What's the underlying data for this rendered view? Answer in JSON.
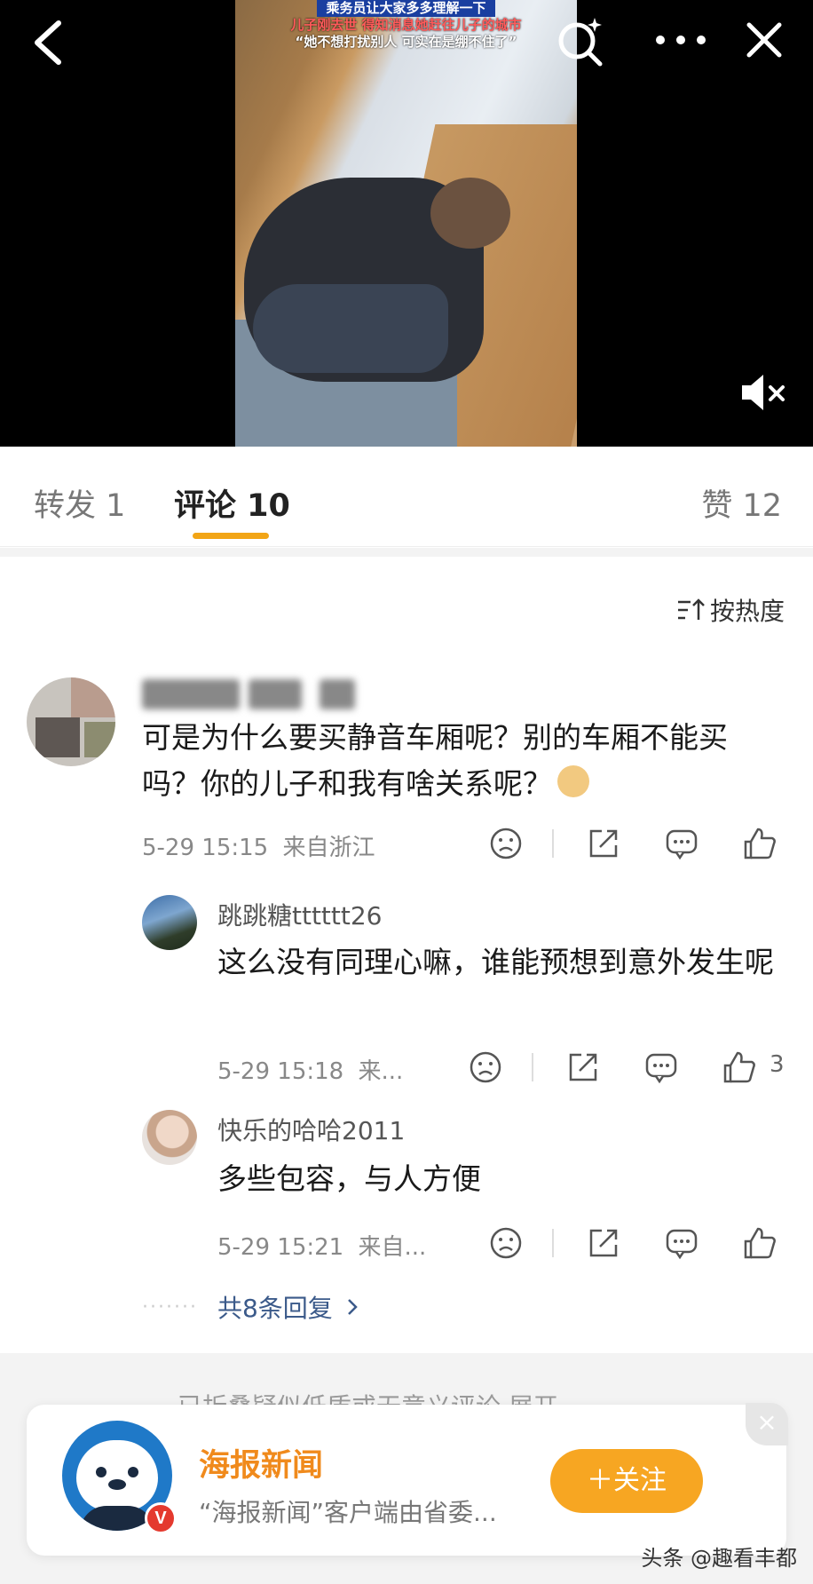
{
  "video": {
    "caption_line1": "乘务员让大家多多理解一下",
    "caption_line2": "儿子刚去世 得知消息她赶往儿子的城市",
    "caption_line3": "“她不想打扰别人 可实在是绷不住了”"
  },
  "tabs": {
    "repost": "转发 1",
    "comment": "评论 10",
    "like": "赞 12"
  },
  "sort": {
    "label": "按热度"
  },
  "comment": {
    "text": "可是为什么要买静音车厢呢？别的车厢不能买吗？你的儿子和我有啥关系呢？",
    "time": "5-29 15:15",
    "location": "来自浙江"
  },
  "replies": [
    {
      "username": "跳跳糖tttttt26",
      "text": "这么没有同理心嘛，谁能预想到意外发生呢",
      "time": "5-29 15:18",
      "location": "来...",
      "likes": "3"
    },
    {
      "username": "快乐的哈哈2011",
      "text": "多些包容，与人方便",
      "time": "5-29 15:21",
      "location": "来自..."
    }
  ],
  "more_replies": "共8条回复",
  "folded_notice": "已折叠疑似低质或无意义评论 展开",
  "follow_card": {
    "title": "海报新闻",
    "description": "“海报新闻”客户端由省委...",
    "button": "＋关注",
    "badge": "V"
  },
  "watermark": "头条 @趣看丰都"
}
